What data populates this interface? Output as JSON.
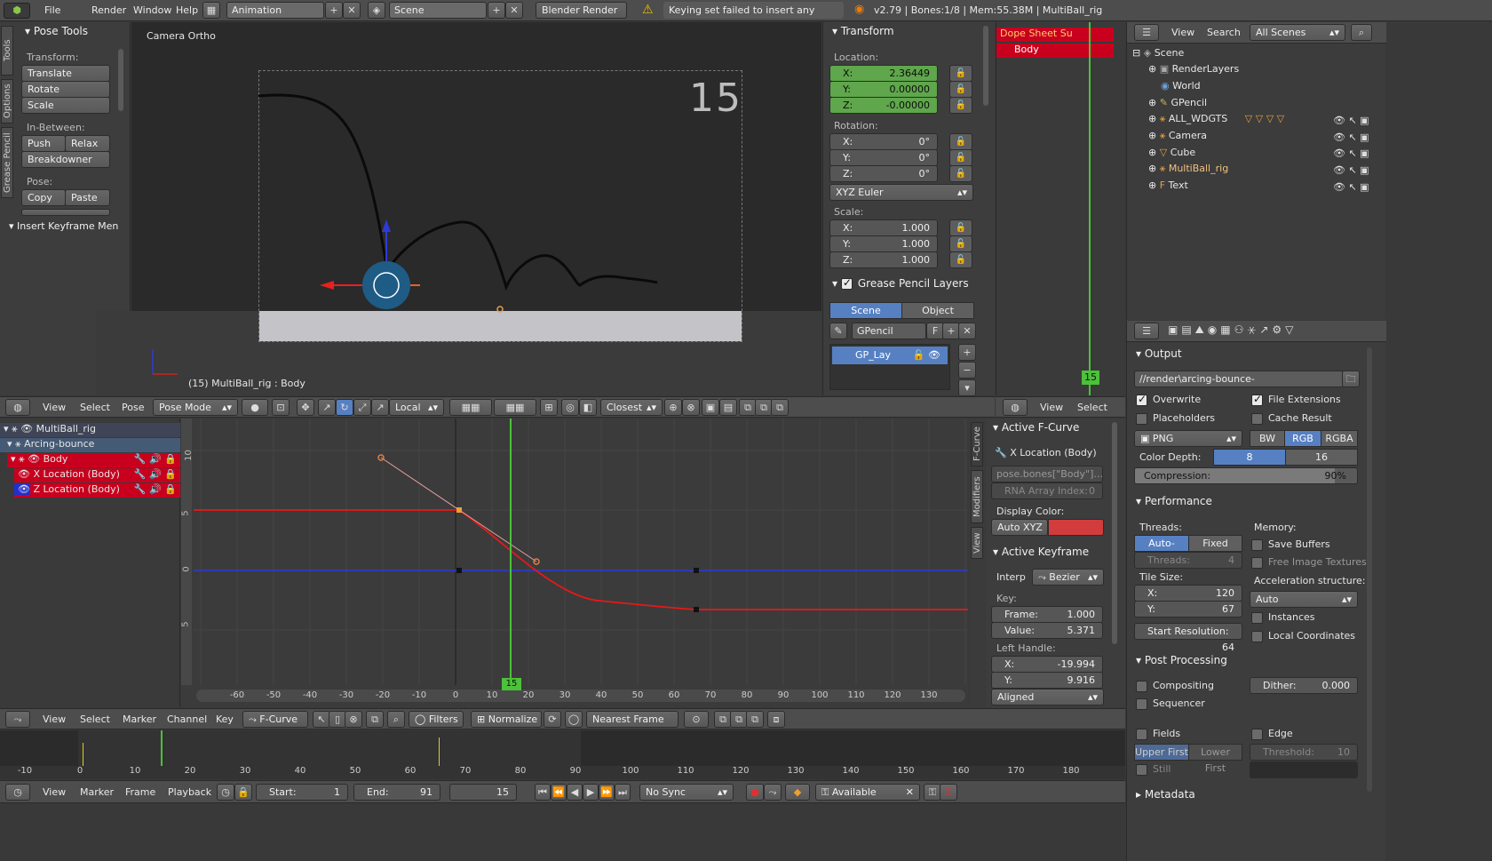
{
  "topbar": {
    "menus": [
      "File",
      "Render",
      "Window",
      "Help"
    ],
    "layout": "Animation",
    "scene": "Scene",
    "engine": "Blender Render",
    "warning": "Keying set failed to insert any keyframes",
    "stats": "v2.79 | Bones:1/8  | Mem:55.38M | MultiBall_rig"
  },
  "toolshelf": {
    "tabs": [
      "Tools",
      "Options",
      "Grease Pencil"
    ],
    "panel_title": "Pose Tools",
    "transform_label": "Transform:",
    "translate": "Translate",
    "rotate": "Rotate",
    "scale": "Scale",
    "inbetween_label": "In-Between:",
    "push": "Push",
    "relax": "Relax",
    "breakdowner": "Breakdowner",
    "pose_label": "Pose:",
    "copy": "Copy",
    "paste": "Paste",
    "insert_kf": "Insert Keyframe Men"
  },
  "viewport": {
    "title": "Camera Ortho",
    "frame_number": "15",
    "status": "(15) MultiBall_rig : Body",
    "header": {
      "view": "View",
      "select": "Select",
      "pose": "Pose",
      "mode": "Pose Mode",
      "orientation": "Local",
      "snap": "Closest"
    }
  },
  "transform_panel": {
    "title": "Transform",
    "location_label": "Location:",
    "location": [
      {
        "axis": "X:",
        "value": "2.36449"
      },
      {
        "axis": "Y:",
        "value": "0.00000"
      },
      {
        "axis": "Z:",
        "value": "-0.00000"
      }
    ],
    "rotation_label": "Rotation:",
    "rotation": [
      {
        "axis": "X:",
        "value": "0°"
      },
      {
        "axis": "Y:",
        "value": "0°"
      },
      {
        "axis": "Z:",
        "value": "0°"
      }
    ],
    "rotation_mode": "XYZ Euler",
    "scale_label": "Scale:",
    "scale": [
      {
        "axis": "X:",
        "value": "1.000"
      },
      {
        "axis": "Y:",
        "value": "1.000"
      },
      {
        "axis": "Z:",
        "value": "1.000"
      }
    ],
    "gp_title": "Grease Pencil Layers",
    "gp_scene": "Scene",
    "gp_object": "Object",
    "gp_name": "GPencil",
    "gp_f": "F",
    "gp_layer": "GP_Lay"
  },
  "dopesheet_mini": {
    "row1": "Dope Sheet Su",
    "row2": "Body",
    "frame": "15",
    "view": "View",
    "select": "Select"
  },
  "outliner": {
    "view": "View",
    "search": "Search",
    "filter": "All Scenes",
    "items": [
      "Scene",
      "RenderLayers",
      "World",
      "GPencil",
      "ALL_WDGTS",
      "Camera",
      "Cube",
      "MultiBall_rig",
      "Text"
    ]
  },
  "graph_editor": {
    "channels": [
      {
        "name": "MultiBall_rig"
      },
      {
        "name": "Arcing-bounce"
      },
      {
        "name": "Body"
      },
      {
        "name": "X Location (Body)"
      },
      {
        "name": "Z Location (Body)"
      }
    ],
    "y_ticks": [
      "10",
      "5",
      "0",
      "5"
    ],
    "x_ticks": [
      "-60",
      "-50",
      "-40",
      "-30",
      "-20",
      "-10",
      "0",
      "10",
      "20",
      "30",
      "40",
      "50",
      "60",
      "70",
      "80",
      "90",
      "100",
      "110",
      "120",
      "130"
    ],
    "current_frame": "15",
    "side_tabs": [
      "F-Curve",
      "Modifiers",
      "View"
    ],
    "header": {
      "view": "View",
      "select": "Select",
      "marker": "Marker",
      "channel": "Channel",
      "key": "Key",
      "mode": "F-Curve",
      "filters": "Filters",
      "normalize": "Normalize",
      "snap": "Nearest Frame"
    }
  },
  "fcurve_panel": {
    "title": "Active F-Curve",
    "name": "X Location (Body)",
    "path": "pose.bones[\"Body\"]....",
    "rna_index_label": "RNA Array Index:",
    "rna_index": "0",
    "display_color_label": "Display Color:",
    "display_color": "Auto XYZ",
    "kf_title": "Active Keyframe",
    "interp_label": "Interp",
    "interp": "Bezier",
    "key_label": "Key:",
    "frame_label": "Frame:",
    "frame": "1.000",
    "value_label": "Value:",
    "value": "5.371",
    "left_handle_label": "Left Handle:",
    "lh_x_label": "X:",
    "lh_x": "-19.994",
    "lh_y_label": "Y:",
    "lh_y": "9.916",
    "handle_type": "Aligned"
  },
  "properties": {
    "output_title": "Output",
    "path": "//render\\arcing-bounce-",
    "overwrite": "Overwrite",
    "file_extensions": "File Extensions",
    "placeholders": "Placeholders",
    "cache_result": "Cache Result",
    "format": "PNG",
    "bw": "BW",
    "rgb": "RGB",
    "rgba": "RGBA",
    "color_depth_label": "Color Depth:",
    "depth8": "8",
    "depth16": "16",
    "compression_label": "Compression:",
    "compression": "90%",
    "performance_title": "Performance",
    "threads_label": "Threads:",
    "auto_detect": "Auto-detect",
    "fixed": "Fixed",
    "threads_field": "Threads:",
    "threads_value": "4",
    "memory_label": "Memory:",
    "save_buffers": "Save Buffers",
    "free_image": "Free Image Textures",
    "tile_size_label": "Tile Size:",
    "tile_x_label": "X:",
    "tile_x": "120",
    "tile_y_label": "Y:",
    "tile_y": "67",
    "accel_label": "Acceleration structure:",
    "accel": "Auto",
    "instances": "Instances",
    "start_res_label": "Start Resolution:",
    "start_res": "64",
    "local_coords": "Local Coordinates",
    "post_title": "Post Processing",
    "compositing": "Compositing",
    "sequencer": "Sequencer",
    "dither_label": "Dither:",
    "dither": "0.000",
    "fields": "Fields",
    "edge": "Edge",
    "upper_first": "Upper First",
    "lower_first": "Lower First",
    "threshold_label": "Threshold:",
    "threshold": "10",
    "still": "Still",
    "metadata_title": "Metadata"
  },
  "timeline": {
    "ticks": [
      "-10",
      "0",
      "10",
      "20",
      "30",
      "40",
      "50",
      "60",
      "70",
      "80",
      "90",
      "100",
      "110",
      "120",
      "130",
      "140",
      "150",
      "160",
      "170",
      "180"
    ],
    "view": "View",
    "marker": "Marker",
    "frame": "Frame",
    "playback": "Playback",
    "start_label": "Start:",
    "start": "1",
    "end_label": "End:",
    "end": "91",
    "current": "15",
    "sync": "No Sync",
    "keying": "Available"
  }
}
